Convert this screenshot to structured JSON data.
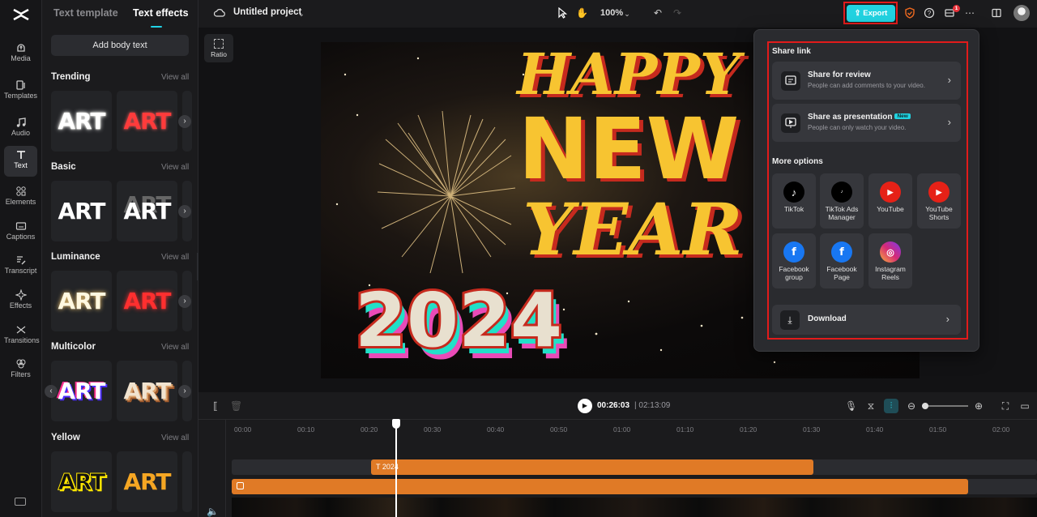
{
  "nav": {
    "items": [
      {
        "label": "Media",
        "icon": "media-icon"
      },
      {
        "label": "Templates",
        "icon": "templates-icon"
      },
      {
        "label": "Audio",
        "icon": "music-note-icon"
      },
      {
        "label": "Text",
        "icon": "text-icon"
      },
      {
        "label": "Elements",
        "icon": "elements-icon"
      },
      {
        "label": "Captions",
        "icon": "captions-icon"
      },
      {
        "label": "Transcript",
        "icon": "transcript-icon"
      },
      {
        "label": "Effects",
        "icon": "sparkle-icon"
      },
      {
        "label": "Transitions",
        "icon": "transitions-icon"
      },
      {
        "label": "Filters",
        "icon": "filters-icon"
      }
    ],
    "active": "Text"
  },
  "panel": {
    "tabs": [
      "Text template",
      "Text effects"
    ],
    "active_tab": "Text effects",
    "add_body": "Add body text",
    "view_all": "View all",
    "sections": [
      {
        "title": "Trending",
        "cards": [
          "ART",
          "ART"
        ]
      },
      {
        "title": "Basic",
        "cards": [
          "ART",
          "ART"
        ]
      },
      {
        "title": "Luminance",
        "cards": [
          "ART",
          "ART"
        ]
      },
      {
        "title": "Multicolor",
        "cards": [
          "ART",
          "ART"
        ]
      },
      {
        "title": "Yellow",
        "cards": [
          "ART",
          "ART"
        ]
      }
    ]
  },
  "topbar": {
    "project_name": "Untitled project",
    "zoom": "100%",
    "export_label": "Export",
    "notification_count": "1"
  },
  "canvas": {
    "ratio_label": "Ratio",
    "video_text": {
      "line1": "HAPPY",
      "line2": "NEW",
      "line3": "YEAR",
      "line4": "2024"
    }
  },
  "share": {
    "share_link_heading": "Share link",
    "review_title": "Share for review",
    "review_sub": "People can add comments to your video.",
    "presentation_title": "Share as presentation",
    "presentation_tag": "New",
    "presentation_sub": "People can only watch your video.",
    "more_options_heading": "More options",
    "options": [
      {
        "label": "TikTok",
        "icon": "tiktok-icon",
        "color": "#000000"
      },
      {
        "label": "TikTok Ads Manager",
        "icon": "tiktok-ads-icon",
        "color": "#000000"
      },
      {
        "label": "YouTube",
        "icon": "youtube-icon",
        "color": "#e62117"
      },
      {
        "label": "YouTube Shorts",
        "icon": "youtube-shorts-icon",
        "color": "#e62117"
      },
      {
        "label": "Facebook group",
        "icon": "facebook-icon",
        "color": "#1877f2"
      },
      {
        "label": "Facebook Page",
        "icon": "facebook-icon",
        "color": "#1877f2"
      },
      {
        "label": "Instagram Reels",
        "icon": "instagram-icon",
        "color": "#d62976"
      }
    ],
    "download_label": "Download"
  },
  "player": {
    "current_time": "00:26:03",
    "total_time": "02:13:09"
  },
  "timeline": {
    "ticks": [
      "00:00",
      "00:10",
      "00:20",
      "00:30",
      "00:40",
      "00:50",
      "01:00",
      "01:10",
      "01:20",
      "01:30",
      "01:40",
      "01:50",
      "02:00"
    ],
    "text_clip_label": "2024"
  },
  "colors": {
    "accent": "#21d2e0",
    "highlight_outline": "#e21b1b",
    "clip_orange": "#e07a26"
  }
}
